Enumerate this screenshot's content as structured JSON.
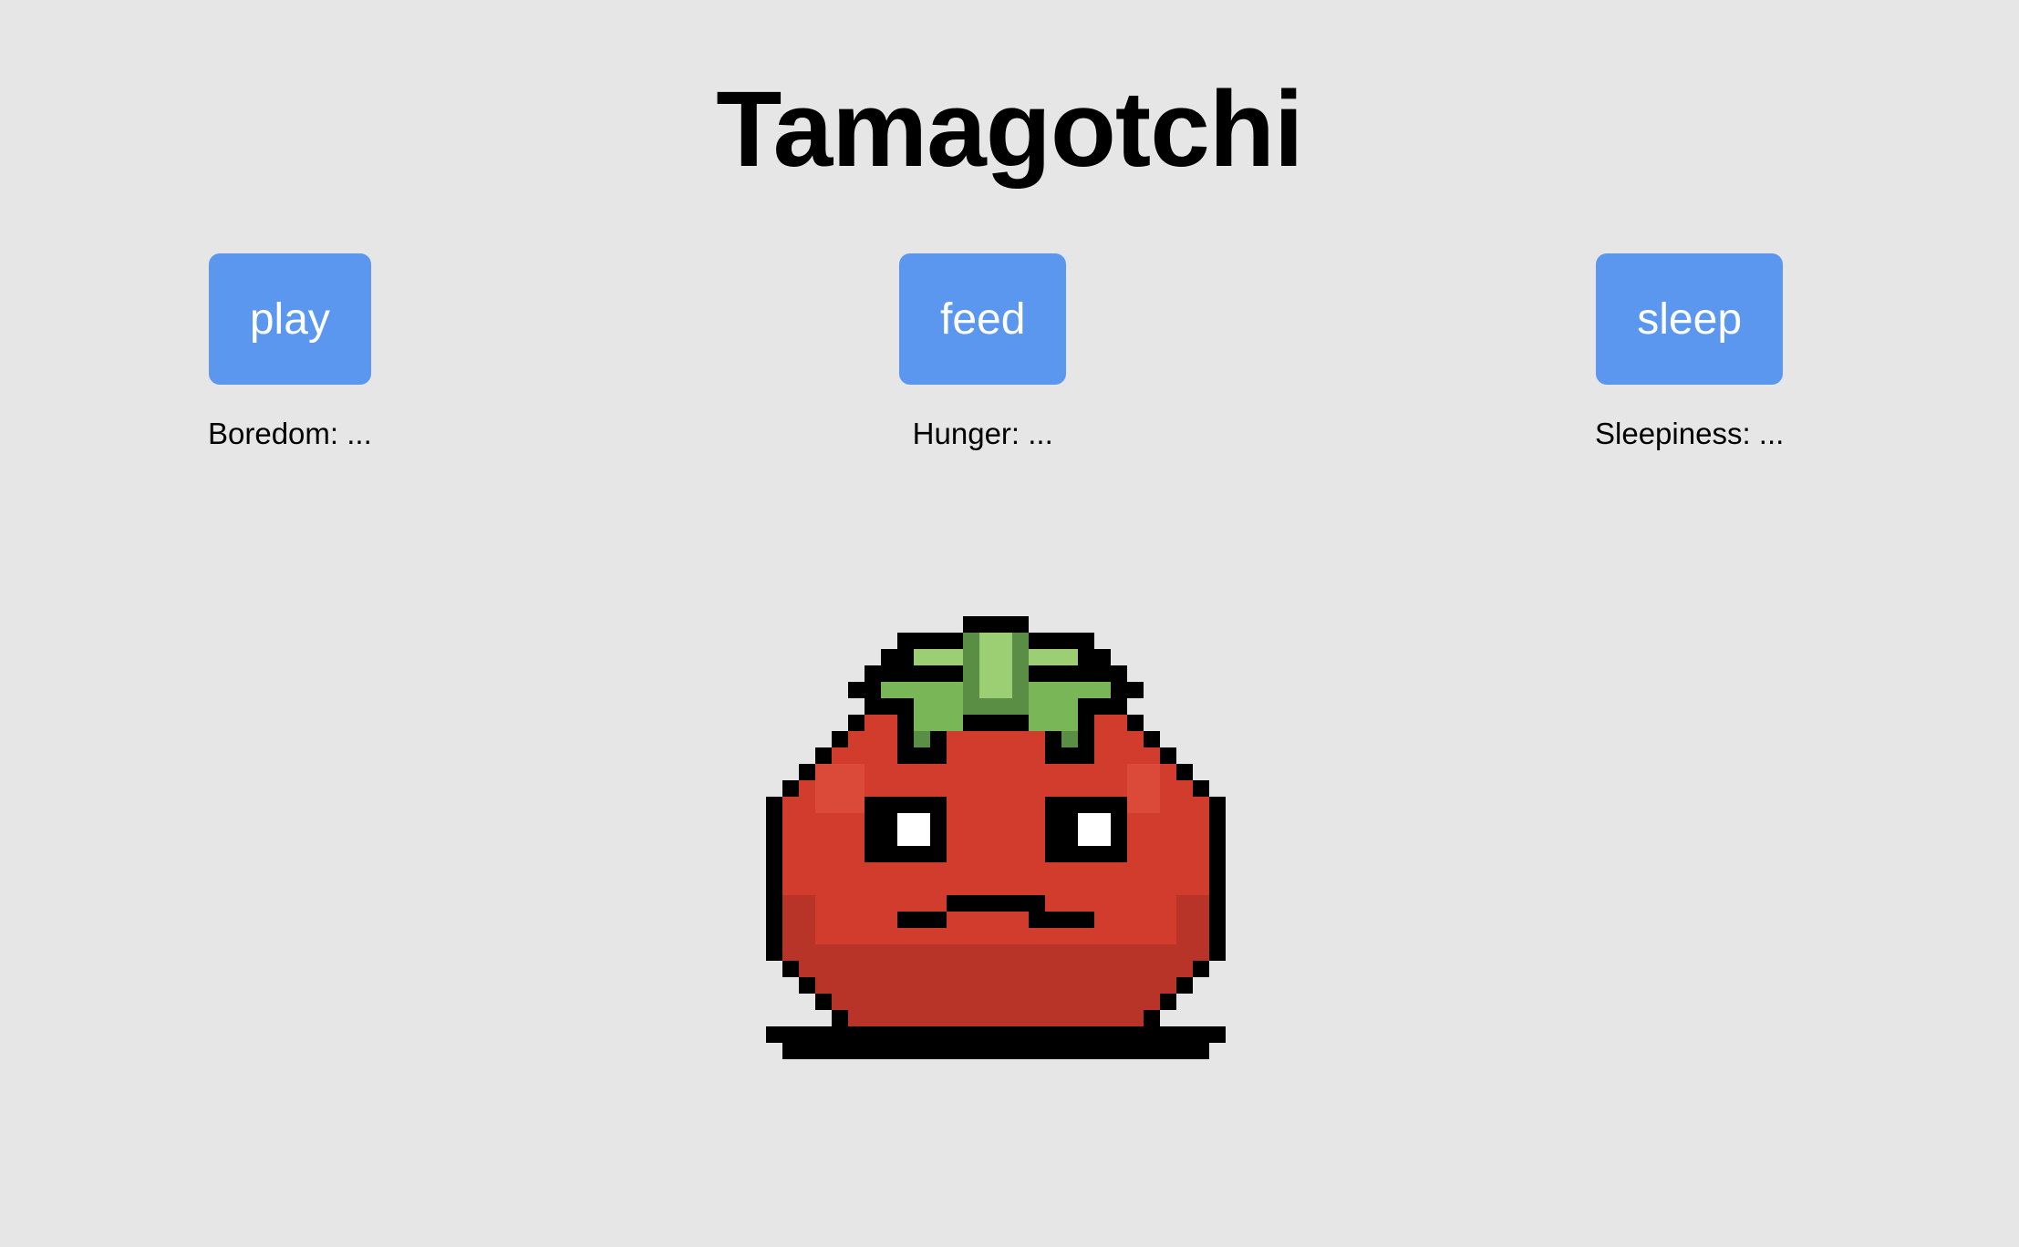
{
  "app": {
    "title": "Tamagotchi"
  },
  "actions": [
    {
      "label": "play",
      "stat_label": "Boredom: ..."
    },
    {
      "label": "feed",
      "stat_label": "Hunger: ..."
    },
    {
      "label": "sleep",
      "stat_label": "Sleepiness: ..."
    }
  ],
  "pet": {
    "icon": "tomato-pet-icon",
    "colors": {
      "outline": "#000000",
      "body": "#d23c2c",
      "body_shade": "#b93428",
      "body_highlight": "#db4a38",
      "leaf_light": "#9ccf73",
      "leaf": "#78b658",
      "leaf_dark": "#5a8e44",
      "eye_white": "#ffffff"
    }
  },
  "theme": {
    "background": "#e6e6e6",
    "button": "#5b97ef",
    "button_text": "#ffffff"
  }
}
